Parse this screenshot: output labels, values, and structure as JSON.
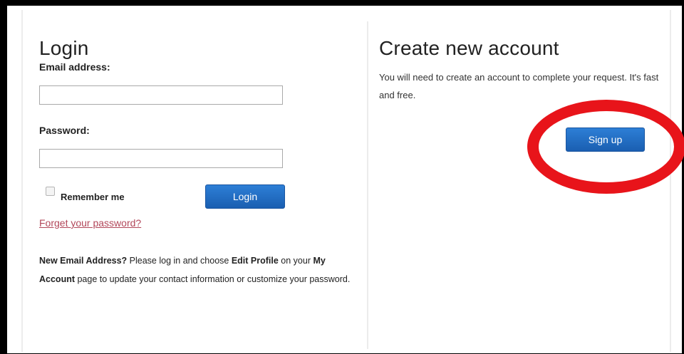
{
  "login": {
    "title": "Login",
    "email_label": "Email address:",
    "email_value": "",
    "password_label": "Password:",
    "password_value": "",
    "remember_label": "Remember me",
    "remember_checked": false,
    "login_button": "Login",
    "forgot_link": "Forget your password?",
    "info": {
      "part1": "New Email Address?",
      "part2": " Please log in and choose ",
      "part3": "Edit Profile",
      "part4": " on your ",
      "part5": "My Account",
      "part6": " page to update your contact information or customize your password."
    }
  },
  "create": {
    "title": "Create new account",
    "description": "You will need to create an account to complete your request. It's fast and free.",
    "signup_button": "Sign up"
  },
  "colors": {
    "button": "#1f68c0",
    "link": "#b2475a",
    "highlight_ring": "#e8141a"
  }
}
